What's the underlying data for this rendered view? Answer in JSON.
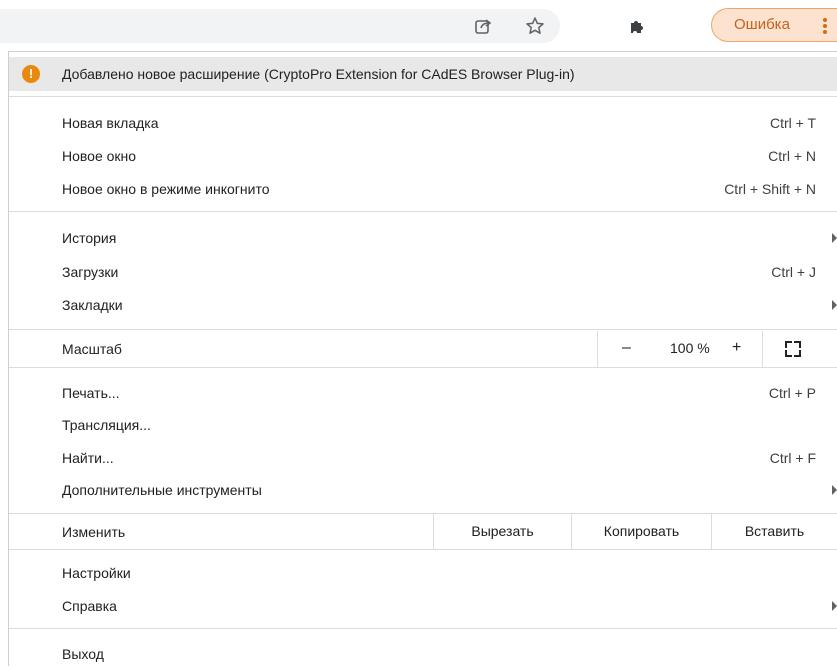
{
  "toolbar": {
    "icons": [
      "share-icon",
      "star-icon",
      "puzzle-icon"
    ],
    "error_button": {
      "label": "Ошибка",
      "color": "#c5621b",
      "bg": "#fde3cf"
    }
  },
  "menu": {
    "notice": {
      "icon": "warning-icon",
      "text": "Добавлено новое расширение (CryptoPro Extension for CAdES Browser Plug-in)"
    },
    "group1": [
      {
        "label": "Новая вкладка",
        "shortcut": "Ctrl + T"
      },
      {
        "label": "Новое окно",
        "shortcut": "Ctrl + N"
      },
      {
        "label": "Новое окно в режиме инкогнито",
        "shortcut": "Ctrl + Shift + N"
      }
    ],
    "group2": [
      {
        "label": "История"
      },
      {
        "label": "Загрузки",
        "shortcut": "Ctrl + J"
      },
      {
        "label": "Закладки"
      }
    ],
    "zoom": {
      "label": "Масштаб",
      "minus": "–",
      "value": "100 %",
      "plus": "+"
    },
    "group3": [
      {
        "label": "Печать...",
        "shortcut": "Ctrl + P"
      },
      {
        "label": "Трансляция..."
      },
      {
        "label": "Найти...",
        "shortcut": "Ctrl + F"
      },
      {
        "label": "Дополнительные инструменты"
      }
    ],
    "edit": {
      "label": "Изменить",
      "cut": "Вырезать",
      "copy": "Копировать",
      "paste": "Вставить"
    },
    "group4": [
      {
        "label": "Настройки"
      },
      {
        "label": "Справка"
      }
    ],
    "exit": {
      "label": "Выход"
    }
  }
}
